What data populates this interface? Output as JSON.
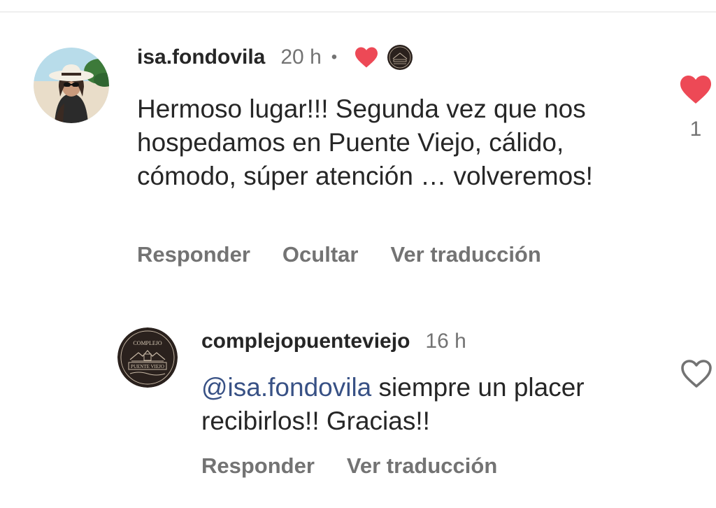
{
  "comment1": {
    "username": "isa.fondovila",
    "time": "20 h",
    "separator": "•",
    "text": "Hermoso lugar!!! Segunda vez que nos hospedamos en Puente Viejo, cálido, cómodo, súper atención … volveremos!",
    "actions": {
      "reply": "Responder",
      "hide": "Ocultar",
      "translate": "Ver traducción"
    },
    "like_count": "1",
    "liked": true,
    "author_liked_icon": "heart-icon",
    "author_avatar_icon": "business-logo"
  },
  "comment2": {
    "username": "complejopuenteviejo",
    "time": "16 h",
    "mention": "@isa.fondovila",
    "text": "siempre un placer recibirlos!! Gracias!!",
    "actions": {
      "reply": "Responder",
      "translate": "Ver traducción"
    },
    "liked": false
  },
  "logo": {
    "top_text": "COMPLEJO",
    "bottom_text": "PUENTE VIEJO"
  },
  "colors": {
    "heart_red": "#ed4956",
    "mention_blue": "#385185",
    "muted_gray": "#737373",
    "text_dark": "#262626"
  }
}
